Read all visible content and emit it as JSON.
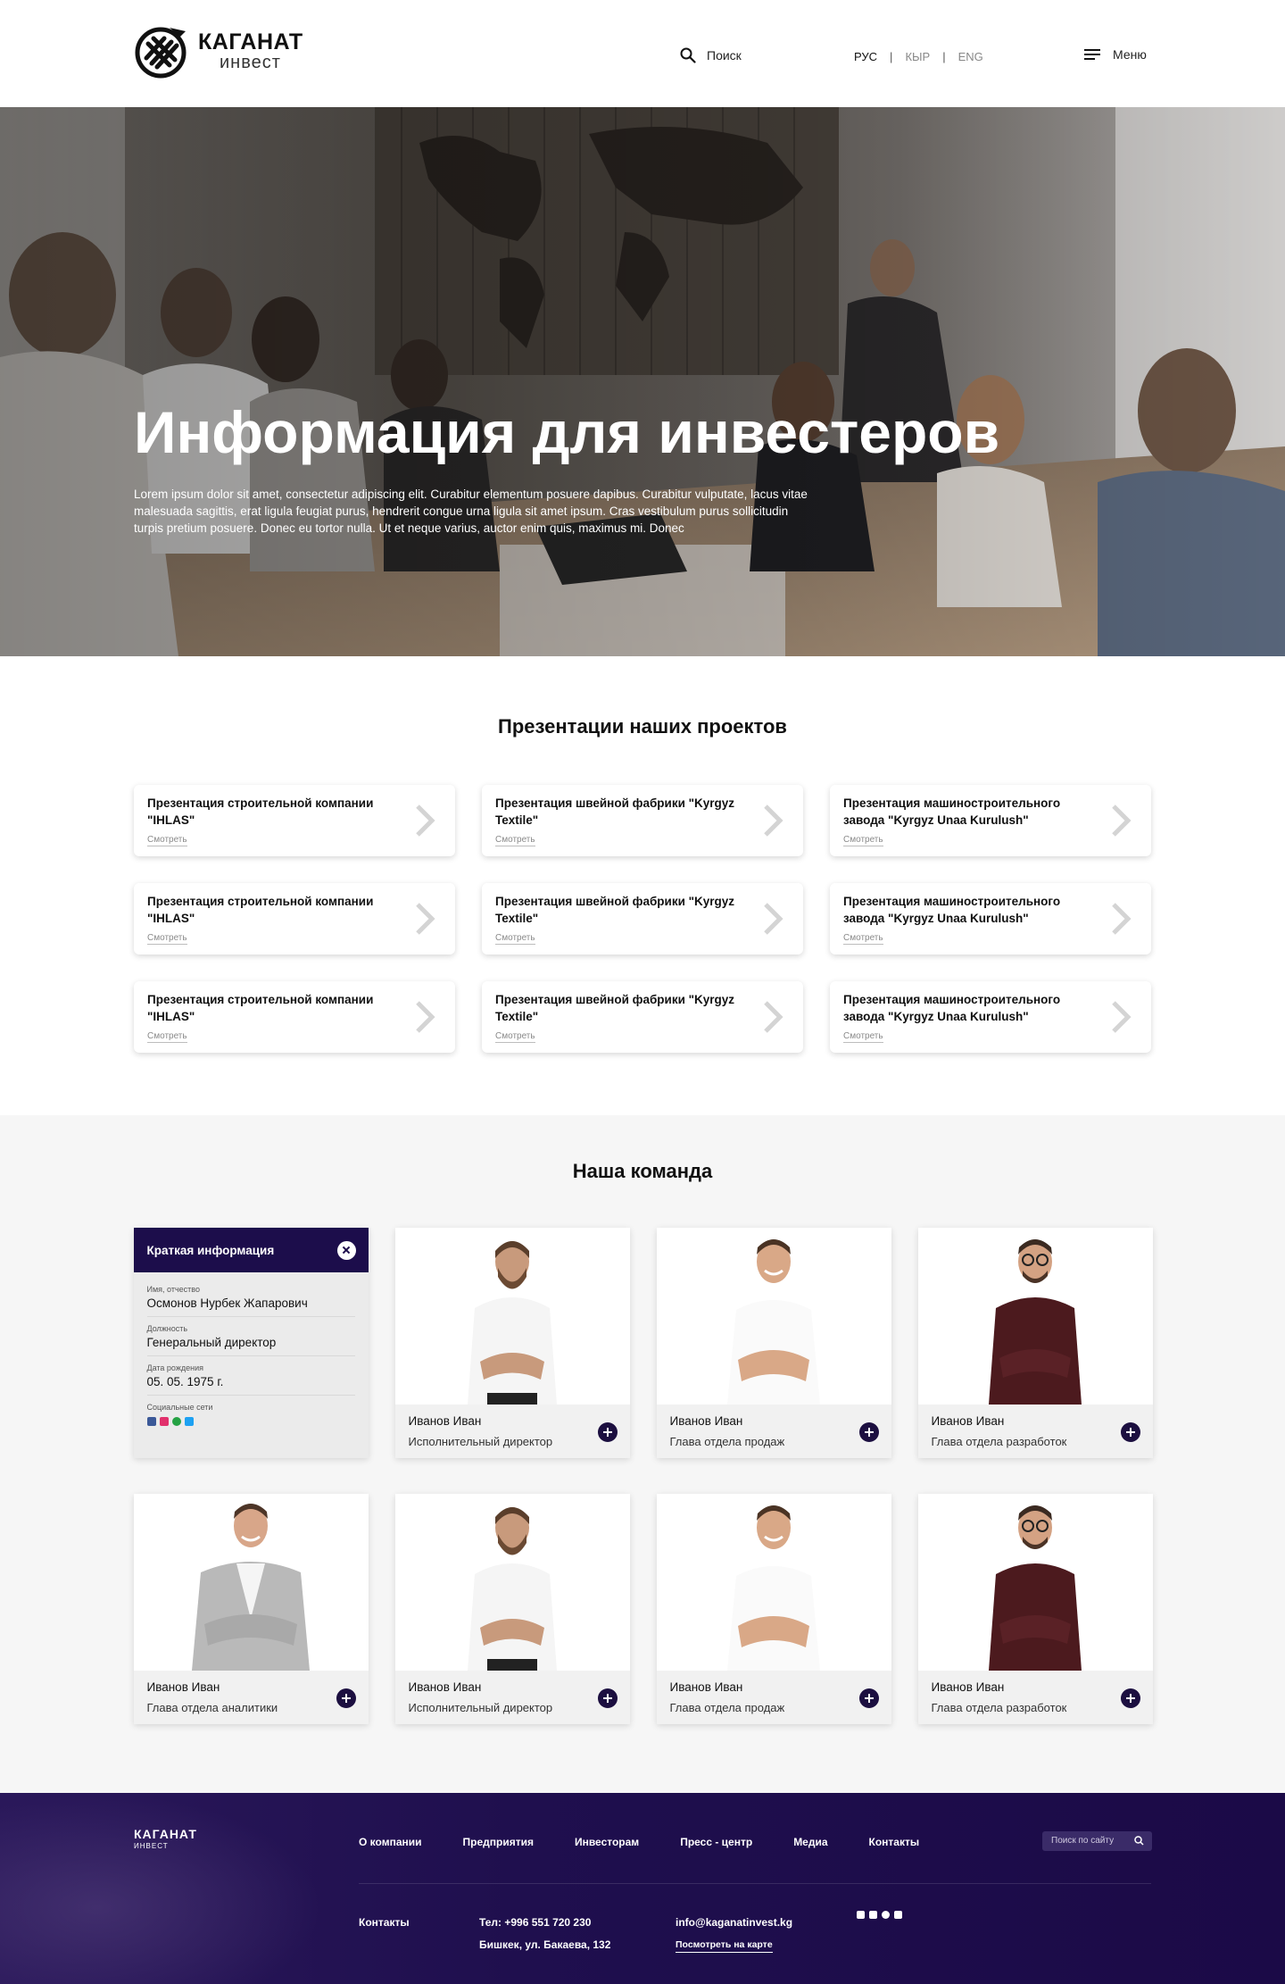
{
  "header": {
    "logo_title": "КАГАНАТ",
    "logo_sub": "инвест",
    "search_label": "Поиск",
    "languages": [
      "РУС",
      "КЫР",
      "ENG"
    ],
    "separator": "|",
    "menu_label": "Меню"
  },
  "hero": {
    "title": "Информация для инвестеров",
    "text": "Lorem ipsum dolor sit amet, consectetur adipiscing elit. Curabitur elementum posuere dapibus. Curabitur vulputate, lacus vitae malesuada sagittis, erat ligula feugiat purus, hendrerit congue urna ligula sit amet ipsum. Cras vestibulum purus sollicitudin turpis pretium posuere. Donec eu tortor nulla. Ut et neque varius, auctor enim quis, maximus mi. Donec"
  },
  "presentations": {
    "title": "Презентации наших проектов",
    "link_label": "Смотреть",
    "cards": [
      {
        "title": "Презентация строительной компании \"IHLAS\""
      },
      {
        "title": "Презентация швейной фабрики \"Kyrgyz Textile\""
      },
      {
        "title": "Презентация машиностроительного завода \"Kyrgyz Unaa Kurulush\""
      },
      {
        "title": "Презентация строительной компании \"IHLAS\""
      },
      {
        "title": "Презентация швейной фабрики \"Kyrgyz Textile\""
      },
      {
        "title": "Презентация машиностроительного завода \"Kyrgyz Unaa Kurulush\""
      },
      {
        "title": "Презентация строительной компании \"IHLAS\""
      },
      {
        "title": "Презентация швейной фабрики \"Kyrgyz Textile\""
      },
      {
        "title": "Презентация машиностроительного завода \"Kyrgyz Unaa Kurulush\""
      }
    ]
  },
  "team": {
    "title": "Наша команда",
    "info_card": {
      "title": "Краткая информация",
      "fields": [
        {
          "label": "Имя, отчество",
          "value": "Осмонов Нурбек Жапарович"
        },
        {
          "label": "Должность",
          "value": "Генеральный директор"
        },
        {
          "label": "Дата рождения",
          "value": "05. 05. 1975 г."
        }
      ],
      "socials_label": "Социальные сети",
      "socials": [
        "facebook-icon",
        "instagram-icon",
        "whatsapp-icon",
        "twitter-icon"
      ]
    },
    "members": [
      {
        "name": "Иванов Иван",
        "role": "Исполнительный директор",
        "photo": "bearded-man"
      },
      {
        "name": "Иванов Иван",
        "role": "Глава отдела продаж",
        "photo": "smiling-man"
      },
      {
        "name": "Иванов Иван",
        "role": "Глава отдела разработок",
        "photo": "man-with-glasses"
      },
      {
        "name": "Иванов Иван",
        "role": "Глава отдела аналитики",
        "photo": "man-in-grey-blazer"
      },
      {
        "name": "Иванов Иван",
        "role": "Исполнительный директор",
        "photo": "bearded-man"
      },
      {
        "name": "Иванов Иван",
        "role": "Глава отдела продаж",
        "photo": "smiling-man"
      },
      {
        "name": "Иванов Иван",
        "role": "Глава отдела разработок",
        "photo": "man-with-glasses"
      }
    ]
  },
  "footer": {
    "logo_title": "КАГАНАТ",
    "logo_sub": "ИНВЕСТ",
    "nav": [
      "О компании",
      "Предприятия",
      "Инвесторам",
      "Пресс - центр",
      "Медиа",
      "Контакты"
    ],
    "search_placeholder": "Поиск по сайту",
    "contacts_label": "Контакты",
    "phone": "Тел: +996 551 720 230",
    "address": "Бишкек, ул. Бакаева, 132",
    "email": "info@kaganatinvest.kg",
    "map_link": "Посмотреть на карте",
    "socials": [
      "facebook-icon",
      "instagram-icon",
      "whatsapp-icon",
      "twitter-icon"
    ]
  },
  "colors": {
    "accent_dark": "#1c0d4b",
    "footer_bg": "#1f0f4e",
    "panel_bg": "#f6f6f6"
  }
}
